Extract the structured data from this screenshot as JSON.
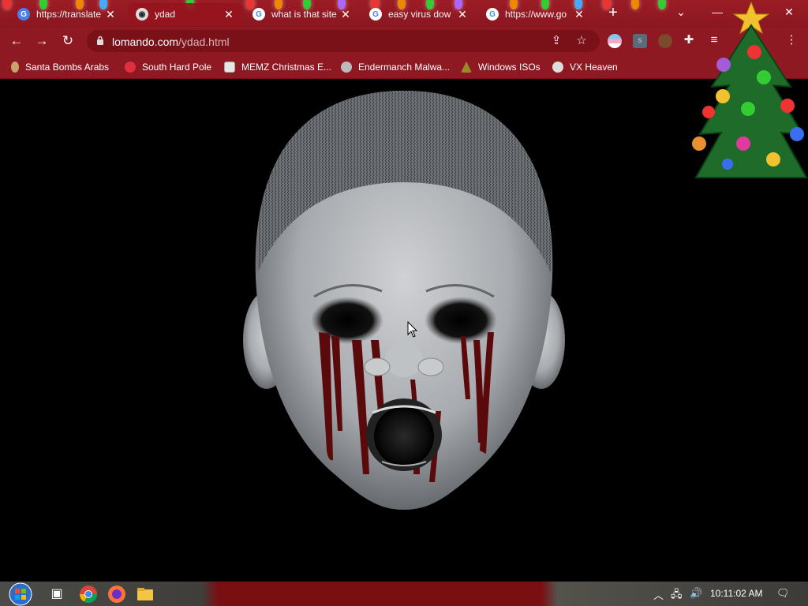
{
  "tabs": [
    {
      "title": "https://translate",
      "icon": "translate-icon",
      "active": false
    },
    {
      "title": "ydad",
      "icon": "raccoon-icon",
      "active": true
    },
    {
      "title": "what is that site",
      "icon": "google-icon",
      "active": false
    },
    {
      "title": "easy virus dow",
      "icon": "google-icon",
      "active": false
    },
    {
      "title": "https://www.go",
      "icon": "google-icon",
      "active": false
    }
  ],
  "new_tab_label": "+",
  "url": {
    "domain": "lomando.com",
    "path": "/ydad.html"
  },
  "bookmarks": [
    {
      "label": "Santa Bombs Arabs",
      "icon": "santa-icon",
      "color": "#c8a36a"
    },
    {
      "label": "South Hard Pole",
      "icon": "flower-icon",
      "color": "#e03040"
    },
    {
      "label": "MEMZ Christmas E...",
      "icon": "page-icon",
      "color": "#e6e6e6"
    },
    {
      "label": "Endermanch Malwa...",
      "icon": "raccoon-icon",
      "color": "#bbbbbb"
    },
    {
      "label": "Windows ISOs",
      "icon": "tree-icon",
      "color": "#9c8a2a"
    },
    {
      "label": "VX Heaven",
      "icon": "vx-icon",
      "color": "#dddddd"
    }
  ],
  "taskbar": {
    "time": "10:11:02 AM"
  },
  "colors": {
    "chrome_red": "#8f1922",
    "tab_strip": "#9c1c25",
    "blood": "#5a0a0a"
  }
}
